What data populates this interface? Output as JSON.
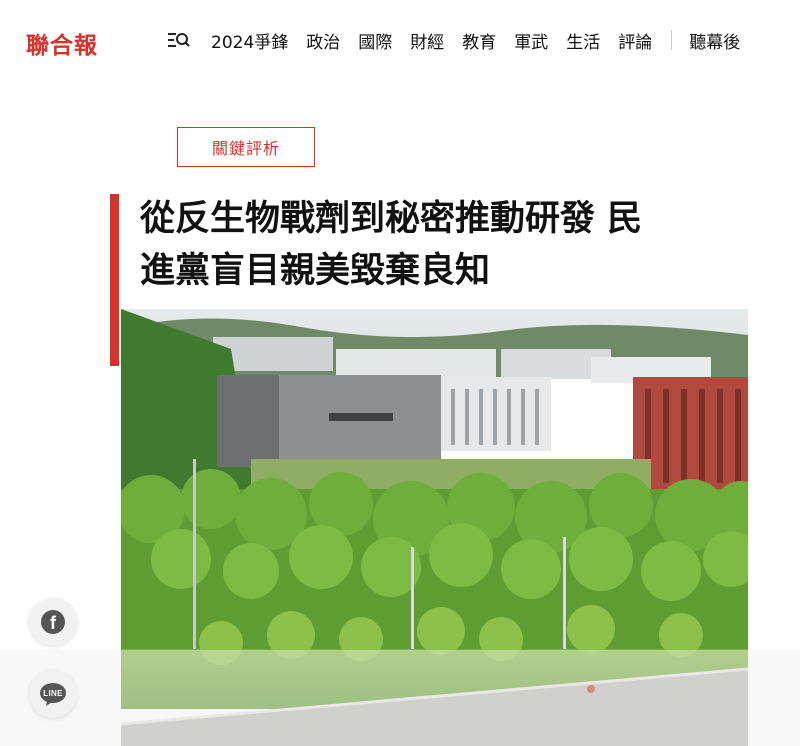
{
  "header": {
    "logo_text": "聯合報",
    "nav": [
      "2024爭鋒",
      "政治",
      "國際",
      "財經",
      "教育",
      "軍武",
      "生活",
      "評論"
    ],
    "nav_extra": "聽幕後"
  },
  "article": {
    "tag": "關鍵評析",
    "headline_line1": "從反生物戰劑到秘密推動研發 民",
    "headline_line2": "進黨盲目親美毀棄良知"
  },
  "share": {
    "facebook_label": "f",
    "line_label": "LINE"
  },
  "colors": {
    "brand_red": "#d6312b"
  }
}
